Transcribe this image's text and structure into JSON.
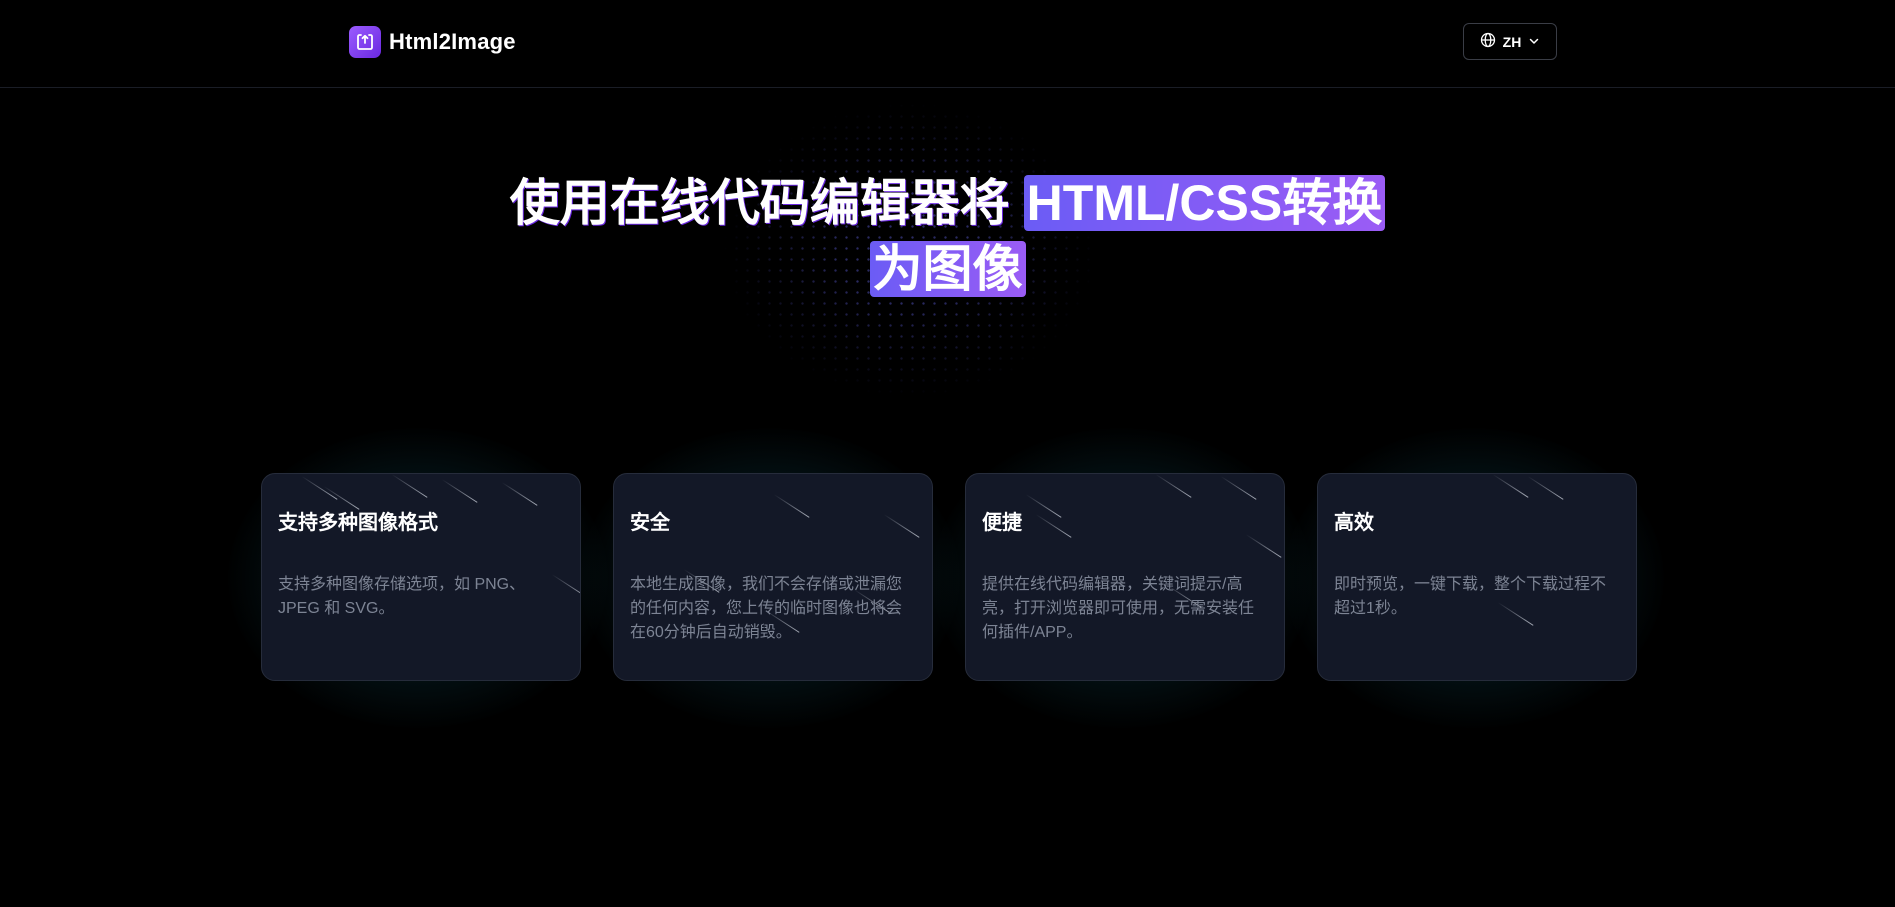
{
  "header": {
    "brand_name": "Html2Image",
    "logo_icon": "upload-frame-icon",
    "language": {
      "label": "ZH",
      "icon": "globe-icon",
      "caret_icon": "chevron-down-icon"
    }
  },
  "hero": {
    "title_plain": "使用在线代码编辑器将",
    "title_highlight_line1": "HTML/CSS转换",
    "title_highlight_line2": "为图像"
  },
  "features": [
    {
      "title": "支持多种图像格式",
      "description": "支持多种图像存储选项，如 PNG、JPEG 和 SVG。"
    },
    {
      "title": "安全",
      "description": "本地生成图像，我们不会存储或泄漏您的任何内容，您上传的临时图像也将会在60分钟后自动销毁。"
    },
    {
      "title": "便捷",
      "description": "提供在线代码编辑器，关键词提示/高亮，打开浏览器即可使用，无需安装任何插件/APP。"
    },
    {
      "title": "高效",
      "description": "即时预览，一键下载，整个下载过程不超过1秒。"
    }
  ],
  "colors": {
    "background": "#000000",
    "accent_purple": "#9b5cf5",
    "accent_indigo": "#6b5cf5",
    "card_bg": "#131827",
    "card_text": "#7d8494",
    "glow_teal": "#148296"
  }
}
